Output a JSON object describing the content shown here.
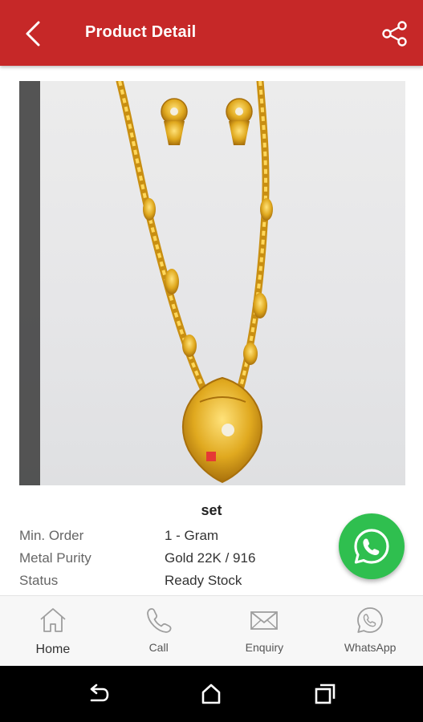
{
  "header": {
    "title": "Product Detail",
    "back_icon": "back-arrow-icon",
    "share_icon": "share-icon"
  },
  "product": {
    "name": "set",
    "image_alt": "Gold necklace set with earrings"
  },
  "specs": [
    {
      "label": "Min. Order",
      "value": "1 - Gram"
    },
    {
      "label": "Metal Purity",
      "value": "Gold 22K / 916"
    },
    {
      "label": "Status",
      "value": "Ready Stock"
    }
  ],
  "fab": {
    "icon": "whatsapp-icon"
  },
  "bottom_nav": [
    {
      "label": "Home",
      "icon": "home-icon",
      "active": true
    },
    {
      "label": "Call",
      "icon": "phone-icon",
      "active": false
    },
    {
      "label": "Enquiry",
      "icon": "mail-icon",
      "active": false
    },
    {
      "label": "WhatsApp",
      "icon": "whatsapp-icon",
      "active": false
    }
  ],
  "system_nav": {
    "back": "system-back-icon",
    "home": "system-home-icon",
    "recents": "system-recents-icon"
  },
  "colors": {
    "appbar": "#c62828",
    "whatsapp": "#2fbf4f",
    "gold": "#d9a21b"
  }
}
